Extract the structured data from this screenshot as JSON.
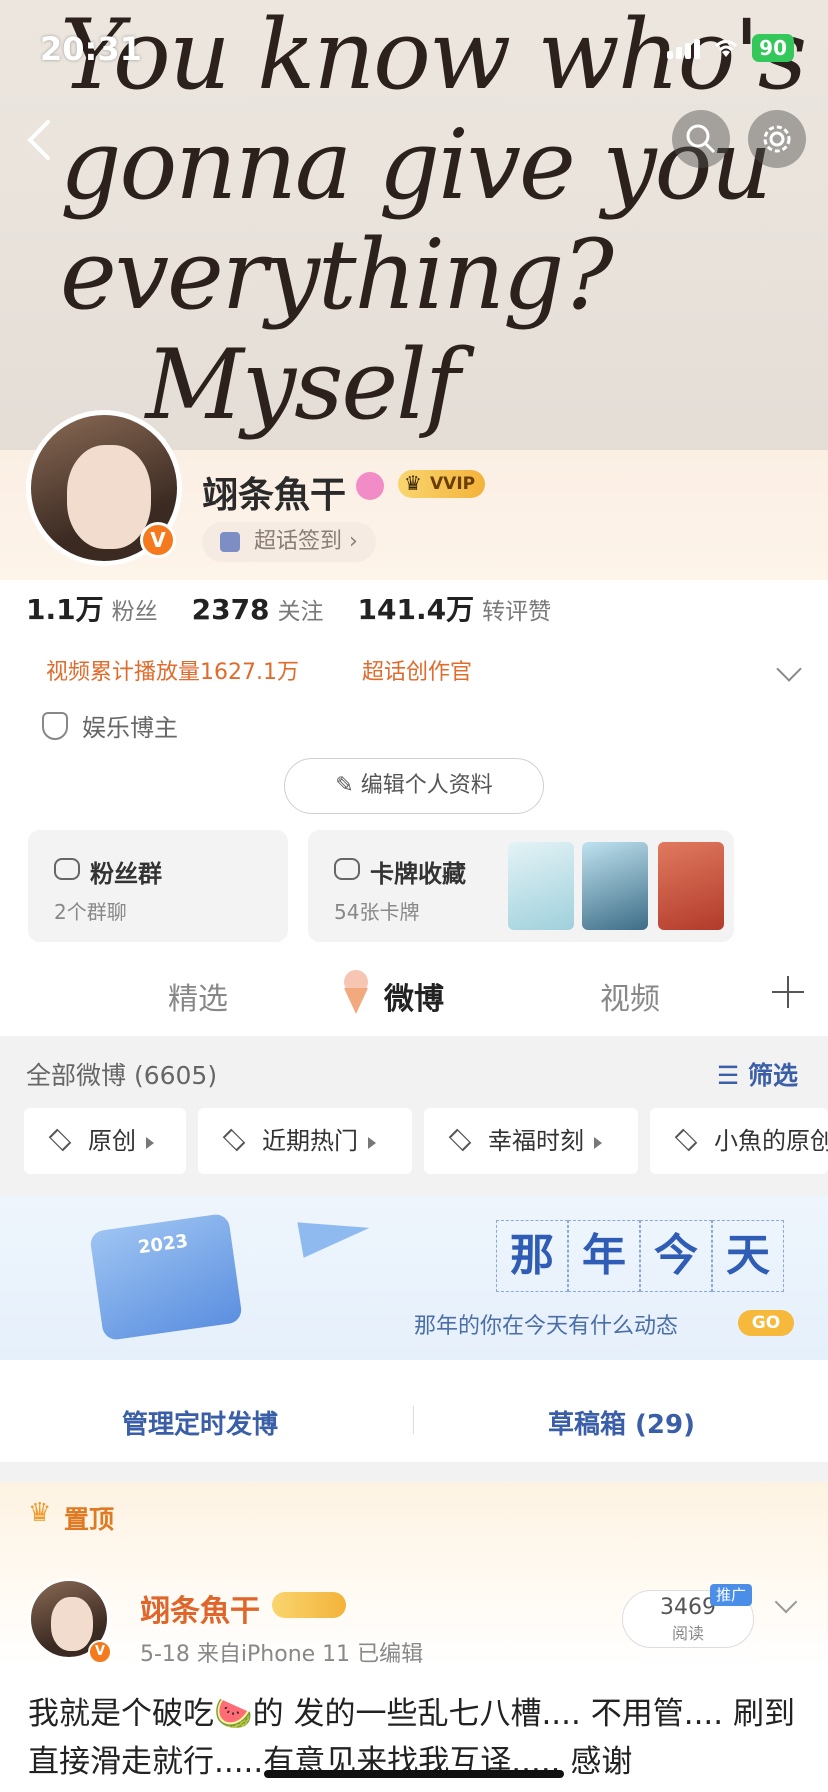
{
  "status_bar": {
    "time": "20:31",
    "battery": "90"
  },
  "cover": {
    "handwriting": "You know who's\ngonna give you\neverything?\n   Myself"
  },
  "profile": {
    "name": "翊条魚干",
    "vip_label": "VVIP",
    "checkin_label": "超话签到 ›",
    "verified_badge": "V",
    "stats": [
      {
        "num": "1.1万",
        "label": "粉丝"
      },
      {
        "num": "2378",
        "label": "关注"
      },
      {
        "num": "141.4万",
        "label": "转评赞"
      }
    ],
    "tags": [
      "视频累计播放量1627.1万",
      "超话创作官"
    ],
    "role": "娱乐博主",
    "edit_button": "编辑个人资料"
  },
  "cards": {
    "fan_group": {
      "title": "粉丝群",
      "sub": "2个群聊"
    },
    "card_collection": {
      "title": "卡牌收藏",
      "sub": "54张卡牌"
    }
  },
  "tabs": [
    "精选",
    "微博",
    "视频"
  ],
  "active_tab": "微博",
  "feed_header": {
    "all": "全部微博 (6605)",
    "filter": "筛选"
  },
  "filters": [
    "原创",
    "近期热门",
    "幸福时刻",
    "小魚的原创"
  ],
  "banner": {
    "year": "2023",
    "title_chars": [
      "那",
      "年",
      "今",
      "天"
    ],
    "subtitle": "那年的你在今天有什么动态",
    "go": "GO"
  },
  "manage": {
    "scheduled": "管理定时发博",
    "drafts": "草稿箱 (29)"
  },
  "pinned": {
    "label": "置顶",
    "author": "翊条魚干",
    "meta": "5-18  来自iPhone 11  已编辑",
    "reads_num": "3469",
    "reads_label": "阅读",
    "promo": "推广",
    "text": "我就是个破吃🍉的 发的一些乱七八槽.... 不用管.... 刷到直接滑走就行.....有意见来找我互译..... 感谢"
  },
  "colors": {
    "accent_orange": "#e0652a",
    "link_blue": "#3a5ea8"
  }
}
